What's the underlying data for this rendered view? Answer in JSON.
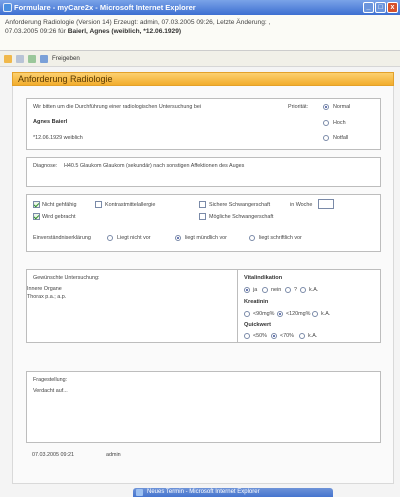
{
  "window": {
    "title": "Formulare - myCare2x - Microsoft Internet Explorer",
    "buttons": {
      "minimize": "_",
      "maximize": "□",
      "close": "x"
    }
  },
  "info": {
    "line1": "Anforderung Radiologie (Version 14) Erzeugt: admin, 07.03.2005 09:26, Letzte Änderung: ,",
    "line2_prefix": "07.03.2005 09:26 für ",
    "patient_bold": "Baierl, Agnes (weiblich, *12.06.1929)"
  },
  "toolbar": {
    "freigeben": "Freigeben"
  },
  "form": {
    "header": "Anforderung Radiologie",
    "request": {
      "intro": "Wir bitten um die Durchführung einer radiologischen Untersuchung bei",
      "patient_name": "Agnes Baierl",
      "patient_info": "*12.06.1929   weiblich",
      "priority_label": "Priorität:",
      "priority_options": [
        "Normal",
        "Hoch",
        "Notfall"
      ],
      "priority_selected": "Normal"
    },
    "diagnosis": {
      "label": "Diagnose:",
      "value": "H40.5 Glaukom Glaukom (sekundär) nach sonstigen Affektionen des Auges"
    },
    "checks": {
      "nicht_gehfaehig": "Nicht gehfähig",
      "kontrastmittelallergie": "Kontrastmittelallergie",
      "sichere_schwangerschaft": "Sichere Schwangerschaft",
      "in_woche": "in Woche",
      "wird_gebracht": "Wird gebracht",
      "moegliche_schwangerschaft": "Mögliche Schwangerschaft",
      "einverstaendnis_label": "Einverständniserklärung",
      "einverstaendnis_options": [
        "Liegt nicht vor",
        "liegt mündlich vor",
        "liegt schriftlich vor"
      ],
      "einverstaendnis_selected": "liegt mündlich vor"
    },
    "examination": {
      "label": "Gewünschte Untersuchung:",
      "lines": [
        "Innere Organe",
        "Thorax p.a.; a.p."
      ]
    },
    "vital": {
      "title": "Vitalindikation",
      "options": [
        "ja",
        "nein",
        "?",
        "k.A."
      ],
      "selected": "ja",
      "kreatinin_title": "Kreatinin",
      "kreatinin_options": [
        "<90mg%",
        "<120mg%",
        "k.A."
      ],
      "kreatinin_selected": "<120mg%",
      "quickwert_title": "Quickwert",
      "quickwert_options": [
        "<50%",
        "<70%",
        "k.A."
      ],
      "quickwert_selected": "<70%"
    },
    "question": {
      "label": "Fragestellung:",
      "value": "Verdacht auf..."
    },
    "footer": {
      "timestamp": "07.03.2005 09:21",
      "user": "admin"
    }
  },
  "taskbar_window": {
    "title": "Neues Termin - Microsoft Internet Explorer"
  }
}
